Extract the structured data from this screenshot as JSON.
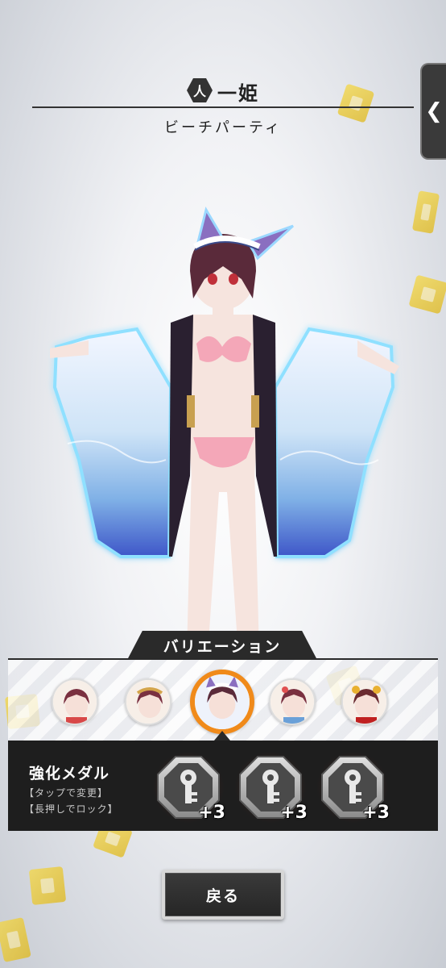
{
  "header": {
    "class_icon_glyph": "人",
    "character_name": "一姫",
    "costume_name": "ビーチパーティ"
  },
  "side_tab": {
    "glyph": "❮"
  },
  "variation": {
    "tab_label": "バリエーション",
    "items": [
      {
        "name": "variation-1",
        "selected": false
      },
      {
        "name": "variation-2",
        "selected": false
      },
      {
        "name": "variation-3",
        "selected": true
      },
      {
        "name": "variation-4",
        "selected": false
      },
      {
        "name": "variation-5",
        "selected": false
      }
    ],
    "selected_color": "#f08a1a"
  },
  "medal_panel": {
    "title": "強化メダル",
    "hint_tap": "【タップで変更】",
    "hint_hold": "【長押しでロック】",
    "medals": [
      {
        "icon": "key-icon",
        "level": "+3"
      },
      {
        "icon": "key-icon",
        "level": "+3"
      },
      {
        "icon": "key-icon",
        "level": "+3"
      }
    ]
  },
  "back_button": {
    "label": "戻る"
  }
}
